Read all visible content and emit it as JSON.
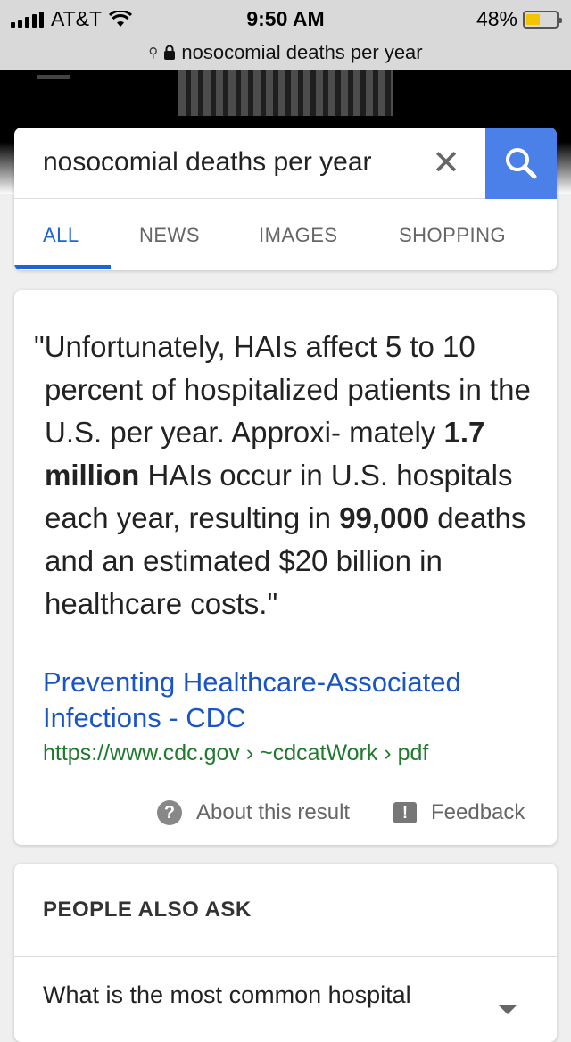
{
  "status_bar": {
    "carrier": "AT&T",
    "time": "9:50 AM",
    "battery": "48%",
    "battery_level": 0.48
  },
  "url_bar": {
    "text": "nosocomial deaths per year",
    "icons": [
      "search-icon",
      "lock-icon"
    ]
  },
  "search": {
    "query": "nosocomial deaths per year",
    "clear_symbol": "✕",
    "accent_color": "#4a80e8"
  },
  "tabs": [
    {
      "label": "ALL",
      "active": true
    },
    {
      "label": "NEWS",
      "active": false
    },
    {
      "label": "IMAGES",
      "active": false
    },
    {
      "label": "SHOPPING",
      "active": false
    }
  ],
  "result": {
    "quote_part1": "\"Unfortunately, HAIs affect 5 to 10 percent of hospitalized patients in the U.S. per year. Approxi- mately ",
    "quote_bold1": "1.7 million",
    "quote_part2": " HAIs occur in U.S. hospitals each year, resulting in ",
    "quote_bold2": "99,000",
    "quote_part3": " deaths and an estimated $20 billion in healthcare costs.\"",
    "title": "Preventing Healthcare-Associated Infections - CDC",
    "url": "https://www.cdc.gov › ~cdcatWork › pdf",
    "about_label": "About this result",
    "feedback_label": "Feedback",
    "link_color": "#1a55c4",
    "url_color": "#1f7a2c"
  },
  "people_also_ask": {
    "title": "PEOPLE ALSO ASK",
    "questions": [
      "What is the most common hospital"
    ]
  }
}
